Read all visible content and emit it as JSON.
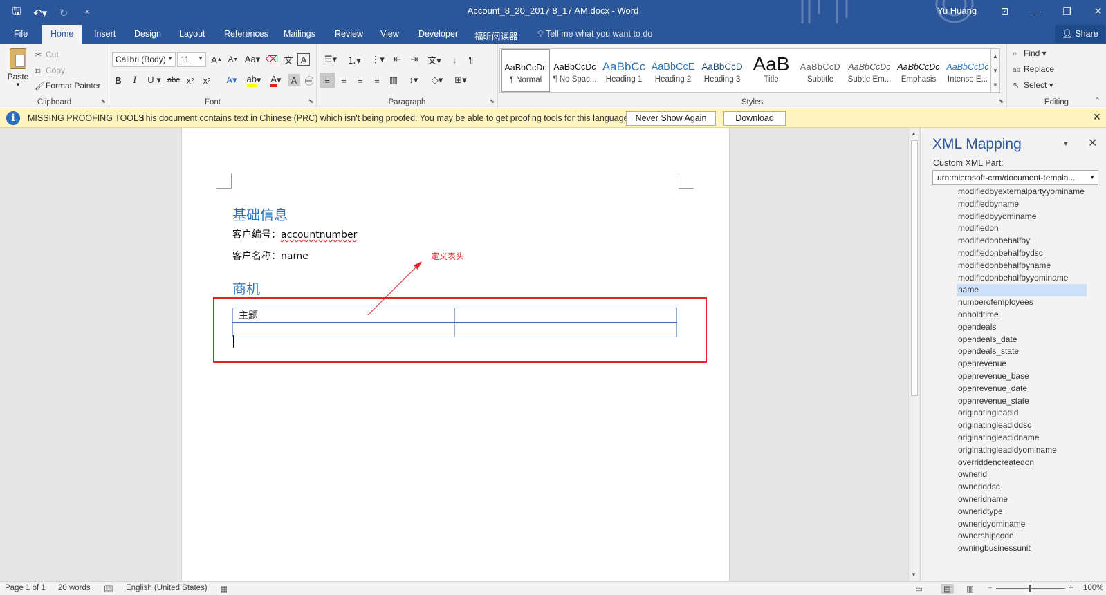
{
  "window": {
    "title": "Account_8_20_2017 8_17 AM.docx  -  Word",
    "user": "Yu Huang"
  },
  "tabs": [
    "File",
    "Home",
    "Insert",
    "Design",
    "Layout",
    "References",
    "Mailings",
    "Review",
    "View",
    "Developer",
    "福昕阅读器"
  ],
  "tell_me": "Tell me what you want to do",
  "share": "Share",
  "ribbon": {
    "clipboard": {
      "label": "Clipboard",
      "paste": "Paste",
      "cut": "Cut",
      "copy": "Copy",
      "format_painter": "Format Painter"
    },
    "font": {
      "label": "Font",
      "name": "Calibri (Body)",
      "size": "11"
    },
    "paragraph": {
      "label": "Paragraph"
    },
    "styles": {
      "label": "Styles",
      "items": [
        {
          "preview": "AaBbCcDc",
          "name": "¶ Normal"
        },
        {
          "preview": "AaBbCcDc",
          "name": "¶ No Spac..."
        },
        {
          "preview": "AaBbCc",
          "name": "Heading 1"
        },
        {
          "preview": "AaBbCcE",
          "name": "Heading 2"
        },
        {
          "preview": "AaBbCcD",
          "name": "Heading 3"
        },
        {
          "preview": "AaB",
          "name": "Title"
        },
        {
          "preview": "AaBbCcD",
          "name": "Subtitle"
        },
        {
          "preview": "AaBbCcDc",
          "name": "Subtle Em..."
        },
        {
          "preview": "AaBbCcDc",
          "name": "Emphasis"
        },
        {
          "preview": "AaBbCcDc",
          "name": "Intense E..."
        }
      ]
    },
    "editing": {
      "label": "Editing",
      "find": "Find",
      "replace": "Replace",
      "select": "Select"
    }
  },
  "message_bar": {
    "heading": "MISSING PROOFING TOOLS",
    "text": "This document contains text in Chinese (PRC) which isn't being proofed. You may be able to get proofing tools for this language.",
    "never_show": "Never Show Again",
    "download": "Download"
  },
  "document": {
    "heading1": "基础信息",
    "line1_label": "客户编号：",
    "line1_value": "accountnumber",
    "line2_label": "客户名称：",
    "line2_value": "name",
    "heading2": "商机",
    "table_header": "主题",
    "annotation": "定义表头"
  },
  "xml_pane": {
    "title": "XML Mapping",
    "custom_part_label": "Custom XML Part:",
    "custom_part_value": "urn:microsoft-crm/document-templa...",
    "selected": "name",
    "items": [
      "modifiedbyexternalpartyyominame",
      "modifiedbyname",
      "modifiedbyyominame",
      "modifiedon",
      "modifiedonbehalfby",
      "modifiedonbehalfbydsc",
      "modifiedonbehalfbyname",
      "modifiedonbehalfbyyominame",
      "name",
      "numberofemployees",
      "onholdtime",
      "opendeals",
      "opendeals_date",
      "opendeals_state",
      "openrevenue",
      "openrevenue_base",
      "openrevenue_date",
      "openrevenue_state",
      "originatingleadid",
      "originatingleadiddsc",
      "originatingleadidname",
      "originatingleadidyominame",
      "overriddencreatedon",
      "ownerid",
      "owneriddsc",
      "owneridname",
      "owneridtype",
      "owneridyominame",
      "ownershipcode",
      "owningbusinessunit"
    ]
  },
  "status": {
    "page": "Page 1 of 1",
    "words": "20 words",
    "language": "English (United States)",
    "zoom": "100%"
  },
  "colors": {
    "brand": "#2b579a",
    "annotation": "#e8202a",
    "heading": "#2e74b5"
  }
}
